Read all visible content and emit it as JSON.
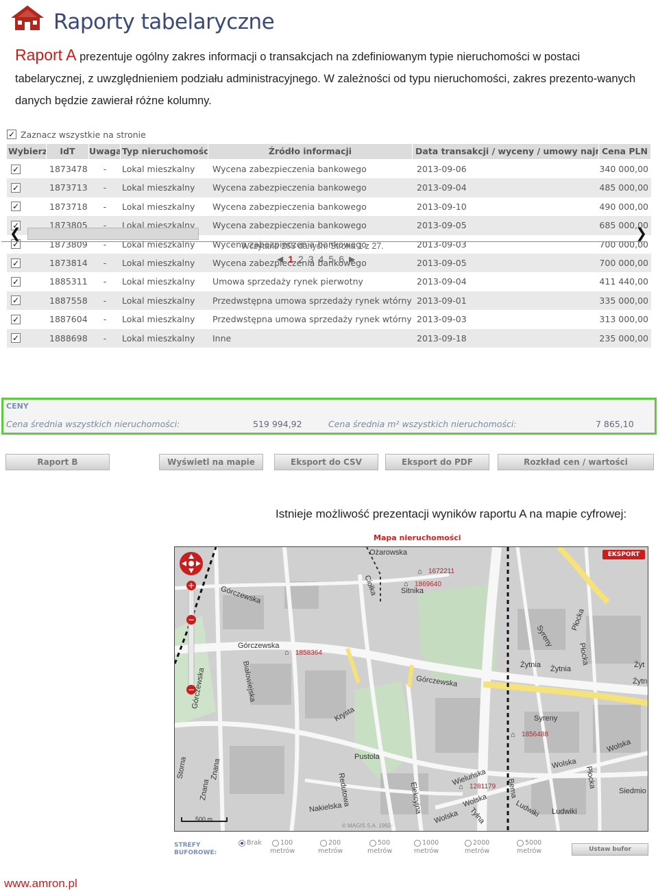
{
  "header": {
    "title": "Raporty tabelaryczne"
  },
  "intro": {
    "lead": "Raport A",
    "text": " prezentuje ogólny zakres informacji o transakcjach na zdefiniowanym typie nieruchomości w postaci tabelarycznej, z uwzględnieniem podziału administracyjnego. W zależności od typu nieruchomości, zakres prezento-wanych danych będzie zawierał różne kolumny."
  },
  "report": {
    "select_all": "Zaznacz wszystkie na stronie",
    "columns": [
      "Wybierz",
      "IdT",
      "Uwaga",
      "Typ nieruchomości",
      "Źródło informacji",
      "Data transakcji / wyceny / umowy najmu",
      "Cena PLN"
    ],
    "rows": [
      {
        "id": "1873478",
        "uwaga": "-",
        "typ": "Lokal mieszkalny",
        "zrodlo": "Wycena zabezpieczenia bankowego",
        "data": "2013-09-06",
        "cena": "340 000,00"
      },
      {
        "id": "1873713",
        "uwaga": "-",
        "typ": "Lokal mieszkalny",
        "zrodlo": "Wycena zabezpieczenia bankowego",
        "data": "2013-09-04",
        "cena": "485 000,00"
      },
      {
        "id": "1873718",
        "uwaga": "-",
        "typ": "Lokal mieszkalny",
        "zrodlo": "Wycena zabezpieczenia bankowego",
        "data": "2013-09-10",
        "cena": "490 000,00"
      },
      {
        "id": "1873805",
        "uwaga": "-",
        "typ": "Lokal mieszkalny",
        "zrodlo": "Wycena zabezpieczenia bankowego",
        "data": "2013-09-05",
        "cena": "685 000,00"
      },
      {
        "id": "1873809",
        "uwaga": "-",
        "typ": "Lokal mieszkalny",
        "zrodlo": "Wycena zabezpieczenia bankowego",
        "data": "2013-09-03",
        "cena": "700 000,00"
      },
      {
        "id": "1873814",
        "uwaga": "-",
        "typ": "Lokal mieszkalny",
        "zrodlo": "Wycena zabezpieczenia bankowego",
        "data": "2013-09-05",
        "cena": "700 000,00"
      },
      {
        "id": "1885311",
        "uwaga": "-",
        "typ": "Lokal mieszkalny",
        "zrodlo": "Umowa sprzedaży rynek pierwotny",
        "data": "2013-09-04",
        "cena": "411 440,00"
      },
      {
        "id": "1887558",
        "uwaga": "-",
        "typ": "Lokal mieszkalny",
        "zrodlo": "Przedwstępna umowa sprzedaży rynek wtórny",
        "data": "2013-09-01",
        "cena": "335 000,00"
      },
      {
        "id": "1887604",
        "uwaga": "-",
        "typ": "Lokal mieszkalny",
        "zrodlo": "Przedwstępna umowa sprzedaży rynek wtórny",
        "data": "2013-09-03",
        "cena": "313 000,00"
      },
      {
        "id": "1888698",
        "uwaga": "-",
        "typ": "Lokal mieszkalny",
        "zrodlo": "Inne",
        "data": "2013-09-18",
        "cena": "235 000,00"
      }
    ],
    "pager_info": "Wczytano 265 danych. Strona 1 z 27.",
    "pages": [
      "1",
      "2",
      "3",
      "4",
      "5",
      "6"
    ],
    "current_page": "1"
  },
  "prices": {
    "title": "CENY",
    "avg_label": "Cena średnia wszystkich nieruchomości:",
    "avg_value": "519 994,92",
    "avg_m2_label": "Cena średnia m² wszystkich nieruchomości:",
    "avg_m2_value": "7 865,10"
  },
  "buttons": [
    "Raport B",
    "Wyświetl na mapie",
    "Eksport do CSV",
    "Eksport do PDF",
    "Rozkład cen / wartości"
  ],
  "map": {
    "caption": "Istnieje możliwość prezentacji wyników raportu A na mapie cyfrowej:",
    "title": "Mapa nieruchomości",
    "export": "EKSPORT",
    "scale": "500 m",
    "copyright": "© MAGIS S.A. 1992-",
    "markers": [
      "1672211",
      "1869640",
      "1858364",
      "1856488",
      "1281179"
    ],
    "streets": [
      "Ożarowska",
      "Górczewska",
      "Górczewska",
      "Górczewska",
      "Ciołka",
      "Sitnika",
      "Białowiejska",
      "Krysta",
      "Pustola",
      "Redutowa",
      "Elekcyjna",
      "Wieluńska",
      "Wolska",
      "Wolska",
      "Wolska",
      "Wolska",
      "Bema",
      "Tyłna",
      "Ludwiki",
      "Ludwiki",
      "Syreny",
      "Syreny",
      "Płocka",
      "Płocka",
      "Płocka",
      "Płocka",
      "Żytnia",
      "Żytnia",
      "Żyt",
      "Siedmio",
      "Nakielska",
      "Znana",
      "Znana",
      "Storna",
      "Górczewska"
    ]
  },
  "buffers": {
    "title": "STREFY\nBUFOROWE:",
    "options": [
      {
        "value": "Brak",
        "unit": ""
      },
      {
        "value": "100",
        "unit": "metrów"
      },
      {
        "value": "200",
        "unit": "metrów"
      },
      {
        "value": "500",
        "unit": "metrów"
      },
      {
        "value": "1000",
        "unit": "metrów"
      },
      {
        "value": "2000",
        "unit": "metrów"
      },
      {
        "value": "5000",
        "unit": "metrów"
      }
    ],
    "selected": "Brak",
    "button": "Ustaw bufor"
  },
  "footer": {
    "url": "www.amron.pl"
  },
  "colors": {
    "accent": "#cc1a1a",
    "title": "#3a4a78",
    "prices_border": "#5ccc3c"
  }
}
